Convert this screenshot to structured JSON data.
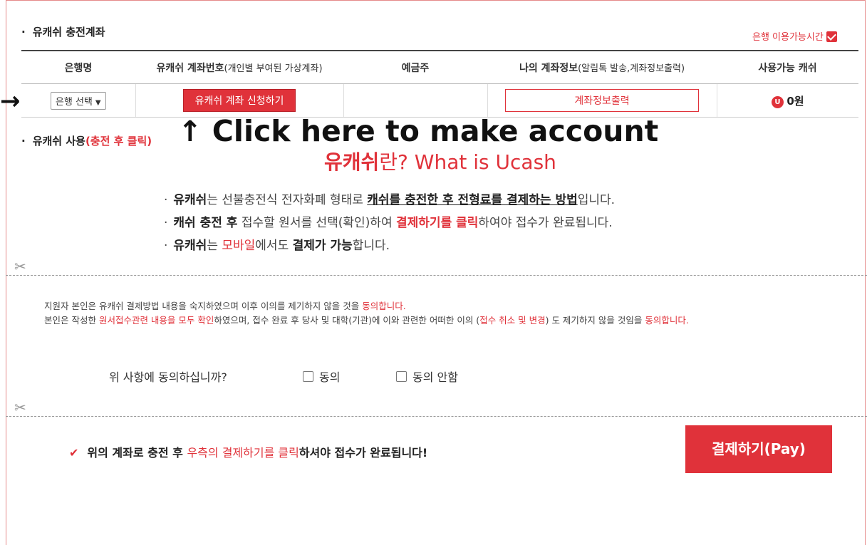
{
  "charge_account": {
    "title": "유캐쉬 충전계좌",
    "bank_hours_link": "은행 이용가능시간",
    "columns": {
      "bank": "은행명",
      "account_main": "유캐쉬 계좌번호",
      "account_sub": "(개인별 부여된 가상계좌)",
      "holder": "예금주",
      "my_info_main": "나의 계좌정보",
      "my_info_sub": "(알림톡 발송,계좌정보출력)",
      "cash": "사용가능 캐쉬"
    },
    "row": {
      "bank_select": "은행 선택",
      "apply_button": "유캐쉬 계좌 신청하기",
      "holder": "",
      "print_button": "계좌정보출력",
      "coin_icon_letter": "U",
      "cash_amount": "0원"
    }
  },
  "annotation": {
    "left_arrow": "→",
    "up_arrow": "↑",
    "text": "Click here to make account"
  },
  "use_section": {
    "title": "유캐쉬 사용",
    "title_note": "(충전 후 클릭)"
  },
  "what_is": {
    "title_bold": "유캐쉬",
    "title_rest": "란? What is Ucash",
    "items": [
      {
        "b1": "유캐쉬",
        "t1": "는 선불충전식 전자화폐 형태로 ",
        "u1": "캐쉬를 충전한 후 전형료를 결제하는 방법",
        "t2": "입니다."
      },
      {
        "b1": "캐쉬 충전 후",
        "t1": " 접수할 원서를 선택(확인)하여 ",
        "r1": "결제하기를 클릭",
        "t2": "하여야 접수가 완료됩니다."
      },
      {
        "b1": "유캐쉬",
        "t1": "는 ",
        "r1": "모바일",
        "t2": "에서도 ",
        "b2": "결제가 가능",
        "t3": "합니다."
      }
    ]
  },
  "agreement": {
    "line1_a": "지원자 본인은 유캐쉬 결제방법 내용을 숙지하였으며 이후 이의를 제기하지 않을 것을 ",
    "line1_r": "동의합니다.",
    "line2_a": "본인은 작성한 ",
    "line2_r1": "원서접수관련 내용을 모두 확인",
    "line2_b": "하였으며, 접수 완료 후 당사 및 대학(기관)에 이와 관련한 어떠한 이의 (",
    "line2_r2": "접수 취소 및 변경",
    "line2_c": ") 도 제기하지 않을 것임을 ",
    "line2_r3": "동의합니다.",
    "question": "위 사항에 동의하십니까?",
    "agree": "동의",
    "disagree": "동의 안함"
  },
  "footer": {
    "check": "✔",
    "note_a": "위의 계좌로 충전 후 ",
    "note_r": "우측의 결제하기를 클릭",
    "note_b": "하셔야 접수가 완료됩니다!",
    "pay_button": "결제하기(Pay)"
  },
  "colors": {
    "accent": "#e0323a"
  }
}
